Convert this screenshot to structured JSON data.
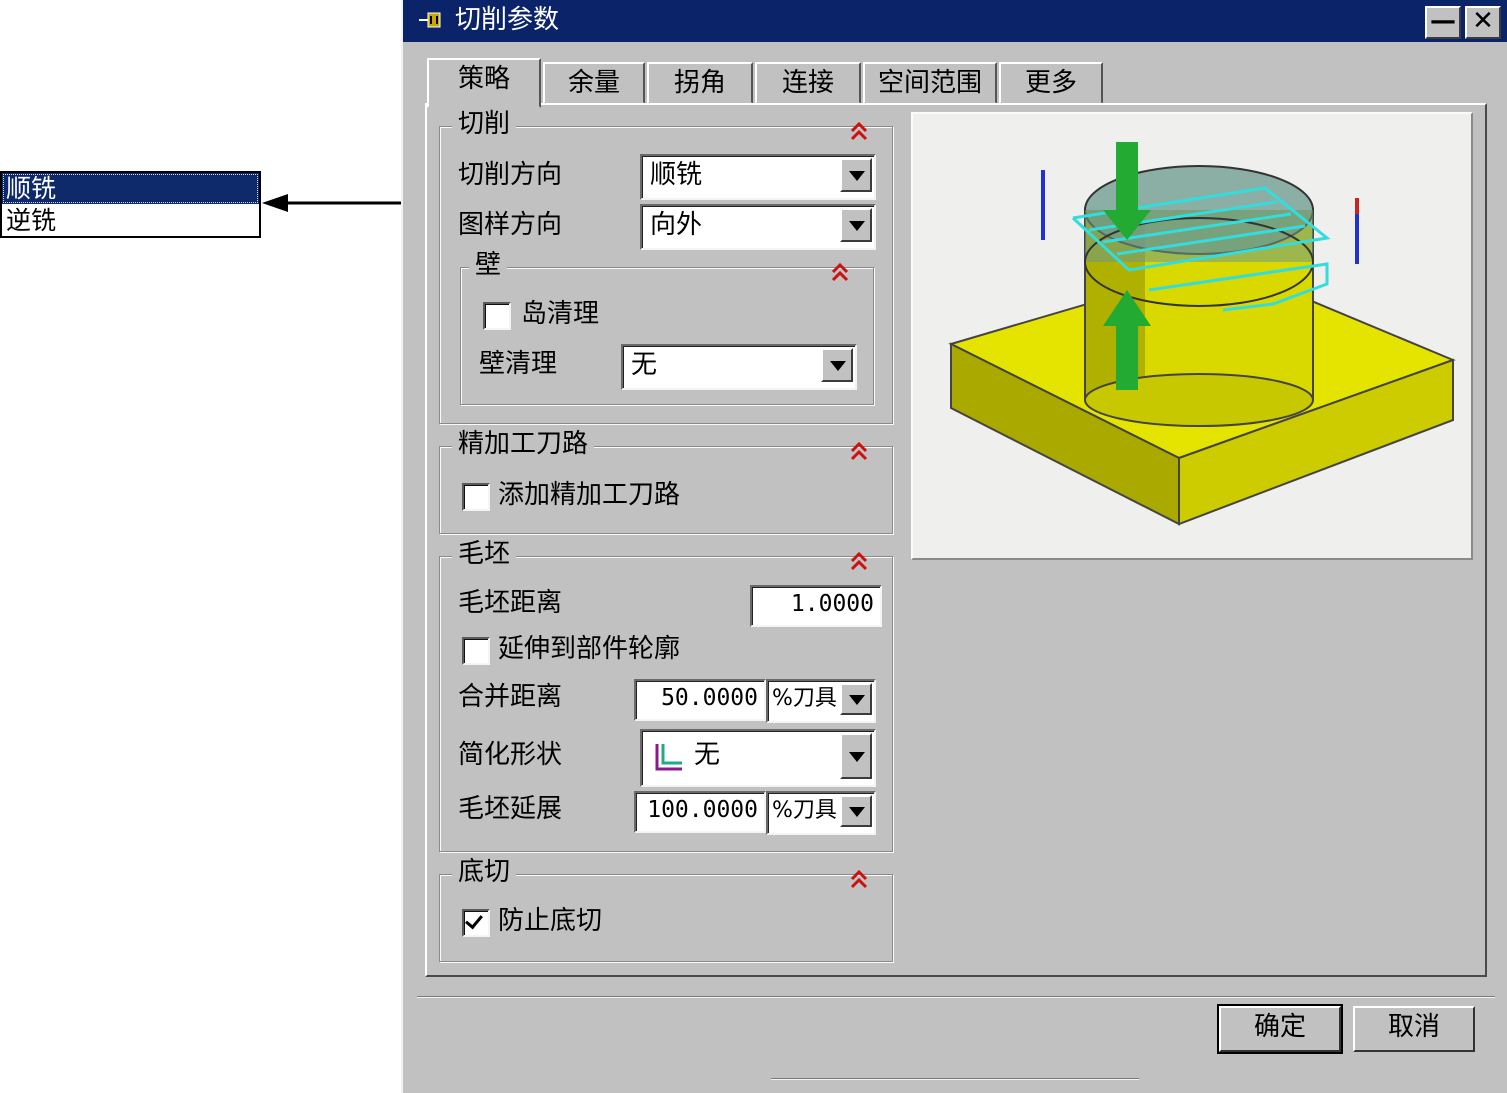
{
  "dropdown_list": {
    "options": [
      "顺铣",
      "逆铣"
    ],
    "selected_index": 0
  },
  "window": {
    "title": "切削参数",
    "minimize_label": "—",
    "close_label": "✕"
  },
  "tabs": [
    "策略",
    "余量",
    "拐角",
    "连接",
    "空间范围",
    "更多"
  ],
  "active_tab": "策略",
  "cutting": {
    "title": "切削",
    "direction_label": "切削方向",
    "direction_value": "顺铣",
    "pattern_direction_label": "图样方向",
    "pattern_direction_value": "向外",
    "wall": {
      "title": "壁",
      "island_cleanup_label": "岛清理",
      "island_cleanup_checked": false,
      "wall_cleanup_label": "壁清理",
      "wall_cleanup_value": "无"
    }
  },
  "finish_pass": {
    "title": "精加工刀路",
    "add_finish_pass_label": "添加精加工刀路",
    "add_finish_pass_checked": false
  },
  "blank": {
    "title": "毛坯",
    "blank_distance_label": "毛坯距离",
    "blank_distance_value": "1.0000",
    "extend_to_part_label": "延伸到部件轮廓",
    "extend_to_part_checked": false,
    "merge_distance_label": "合并距离",
    "merge_distance_value": "50.0000",
    "merge_distance_unit": "%刀具",
    "simplify_shape_label": "简化形状",
    "simplify_shape_value": "无",
    "blank_extension_label": "毛坯延展",
    "blank_extension_value": "100.0000",
    "blank_extension_unit": "%刀具"
  },
  "undercut": {
    "title": "底切",
    "prevent_undercut_label": "防止底切",
    "prevent_undercut_checked": true
  },
  "buttons": {
    "ok": "确定",
    "cancel": "取消"
  },
  "colors": {
    "titlebar": "#0b2369",
    "selection": "#0f2a6a",
    "dialog_bg": "#c1c1c1",
    "collapse_arrow": "#cc1111",
    "part_yellow": "#d8d800",
    "tool_path_cyan": "#33dddd",
    "arrow_green": "#22aa33"
  },
  "icons": {
    "collapse": "double-chevron-up-icon",
    "dropdown": "triangle-down-icon",
    "simplify": "l-corner-icon"
  }
}
